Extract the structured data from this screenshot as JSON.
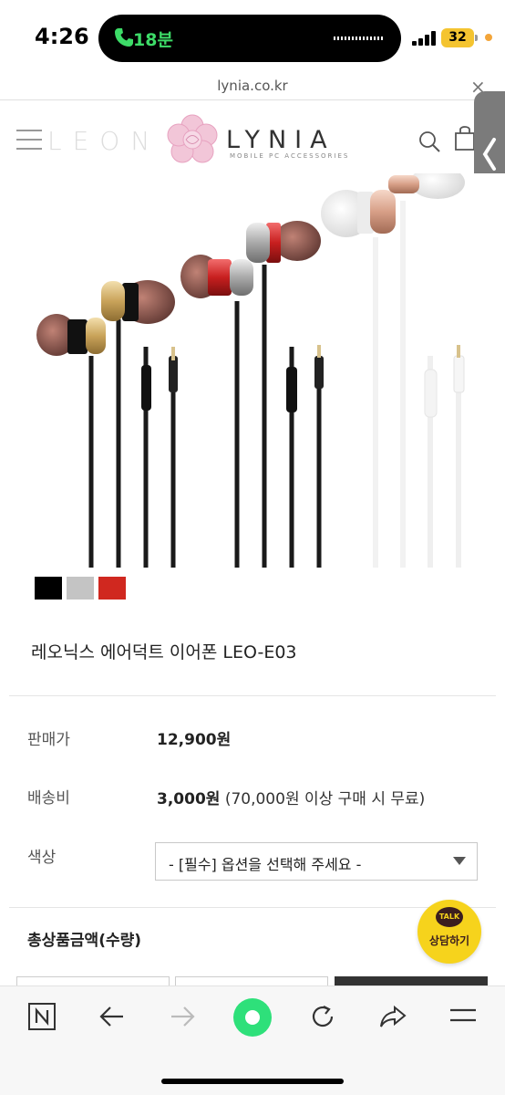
{
  "status_bar": {
    "time": "4:26",
    "call_duration": "18분",
    "battery": "32",
    "battery_color": "#f4c430",
    "call_color": "#3ddc68",
    "dot_color": "#f3a53a"
  },
  "browser": {
    "url": "lynia.co.kr",
    "close_icon": "close-icon"
  },
  "header": {
    "brand_left": "LEON",
    "brand_right": "LYNIA",
    "brand_subtitle": "MOBILE PC ACCESSORIES",
    "menu_icon": "hamburger-icon",
    "search_icon": "search-icon",
    "cart_icon": "cart-icon",
    "side_tab_icon": "chevron-left-icon"
  },
  "product": {
    "title": "레오닉스 에어덕트 이어폰 LEO-E03",
    "swatches": [
      {
        "name": "black",
        "color": "#000000"
      },
      {
        "name": "silver",
        "color": "#c4c4c4"
      },
      {
        "name": "red",
        "color": "#d0281f"
      }
    ],
    "price_label": "판매가",
    "price_value": "12,900원",
    "shipping_label": "배송비",
    "shipping_value": "3,000원",
    "shipping_note": "(70,000원 이상 구매 시 무료)",
    "color_label": "색상",
    "color_select_value": "- [필수] 옵션을 선택해 주세요 -",
    "total_label": "총상품금액(수량)"
  },
  "talk_button": {
    "bubble": "TALK",
    "label": "상담하기",
    "color": "#f6d31c"
  },
  "toolbar": {
    "items": [
      "n-home-icon",
      "back-arrow-icon",
      "forward-arrow-icon",
      "green-dot-icon",
      "refresh-icon",
      "share-icon",
      "menu-icon"
    ]
  }
}
